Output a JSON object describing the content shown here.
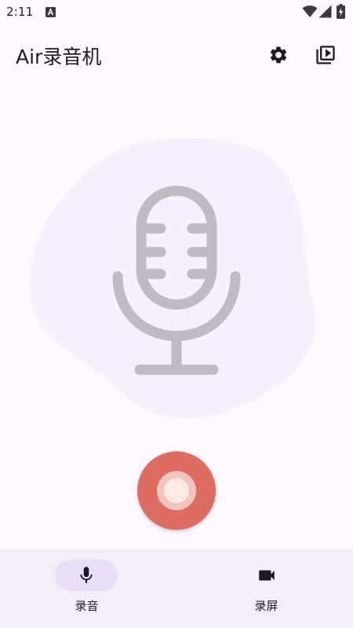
{
  "status_bar": {
    "time": "2:11",
    "notification_icon": "text-a-icon",
    "wifi_icon": "wifi-icon",
    "signal_icon": "cell-signal-icon",
    "battery_icon": "battery-charging-icon"
  },
  "app_bar": {
    "title": "Air录音机",
    "settings_icon": "gear-icon",
    "playlist_icon": "video-library-icon"
  },
  "illustration": {
    "icon": "microphone-icon",
    "blob_color": "#f5f0fb",
    "mic_color": "#c0bac4"
  },
  "record_button": {
    "icon": "record-icon",
    "color": "#dd6c62"
  },
  "bottom_nav": {
    "items": [
      {
        "label": "录音",
        "icon": "mic-icon",
        "selected": true
      },
      {
        "label": "录屏",
        "icon": "videocam-icon",
        "selected": false
      }
    ]
  },
  "colors": {
    "background": "#fdf7ff",
    "nav_background": "#f3edf7",
    "nav_indicator": "#e8def8",
    "text": "#1d1b20"
  }
}
